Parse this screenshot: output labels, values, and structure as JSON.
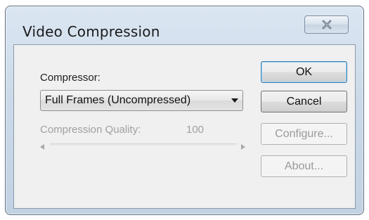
{
  "window": {
    "title": "Video Compression",
    "close_glyph": "✕"
  },
  "compressor": {
    "label": "Compressor:",
    "selected": "Full Frames (Uncompressed)"
  },
  "quality": {
    "label": "Compression Quality:",
    "value": "100",
    "enabled": false
  },
  "buttons": {
    "ok": "OK",
    "cancel": "Cancel",
    "configure": "Configure...",
    "about": "About..."
  },
  "colors": {
    "accent": "#3c7fb1",
    "disabled_text": "#a0a0a0"
  }
}
